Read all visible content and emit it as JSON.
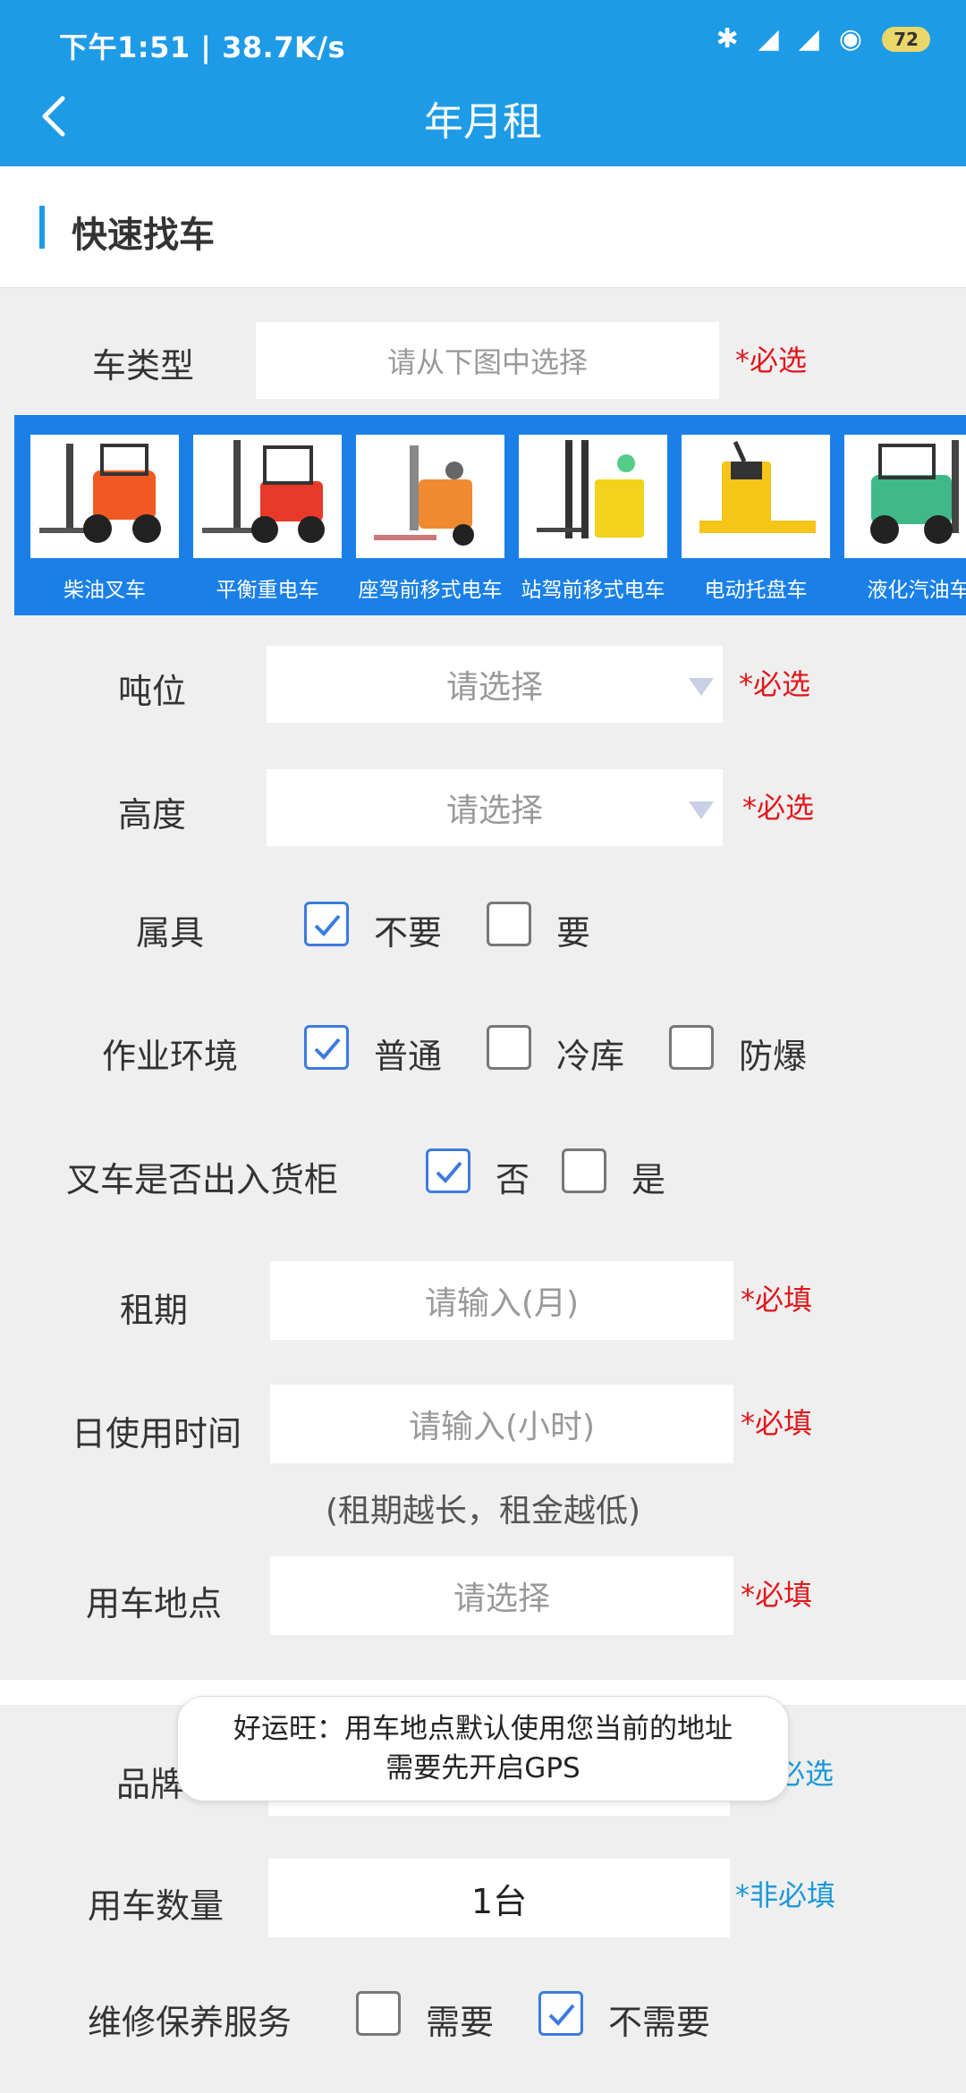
{
  "status": {
    "time_speed": "下午1:51 | 38.7K/s",
    "battery": "72"
  },
  "header": {
    "title": "年月租"
  },
  "section": {
    "title": "快速找车"
  },
  "car_type": {
    "label": "车类型",
    "placeholder": "请从下图中选择",
    "required": "*必选"
  },
  "vehicles": [
    {
      "name": "柴油叉车",
      "color": "#f05a22"
    },
    {
      "name": "平衡重电车",
      "color": "#e8392a"
    },
    {
      "name": "座驾前移式电车",
      "color": "#f08a30"
    },
    {
      "name": "站驾前移式电车",
      "color": "#f2d21a"
    },
    {
      "name": "电动托盘车",
      "color": "#f5c518"
    },
    {
      "name": "液化汽油车",
      "color": "#3fb88a"
    }
  ],
  "tonnage": {
    "label": "吨位",
    "placeholder": "请选择",
    "required": "*必选"
  },
  "height": {
    "label": "高度",
    "placeholder": "请选择",
    "required": "*必选"
  },
  "attachment": {
    "label": "属具",
    "options": [
      "不要",
      "要"
    ],
    "checked": [
      true,
      false
    ]
  },
  "environment": {
    "label": "作业环境",
    "options": [
      "普通",
      "冷库",
      "防爆"
    ],
    "checked": [
      true,
      false,
      false
    ]
  },
  "container": {
    "label": "叉车是否出入货柜",
    "options": [
      "否",
      "是"
    ],
    "checked": [
      true,
      false
    ]
  },
  "lease": {
    "label": "租期",
    "placeholder": "请输入(月)",
    "required": "*必填"
  },
  "daily": {
    "label": "日使用时间",
    "placeholder": "请输入(小时)",
    "required": "*必填",
    "hint": "(租期越长，租金越低)"
  },
  "location": {
    "label": "用车地点",
    "placeholder": "请选择",
    "required": "*必填"
  },
  "brand": {
    "label": "品牌",
    "required": "必选"
  },
  "toast": {
    "line1": "好运旺：用车地点默认使用您当前的地址",
    "line2": "需要先开启GPS"
  },
  "quantity": {
    "label": "用车数量",
    "value": "1台",
    "required": "*非必填"
  },
  "maintenance": {
    "label": "维修保养服务",
    "options": [
      "需要",
      "不需要"
    ],
    "checked": [
      false,
      true
    ]
  }
}
